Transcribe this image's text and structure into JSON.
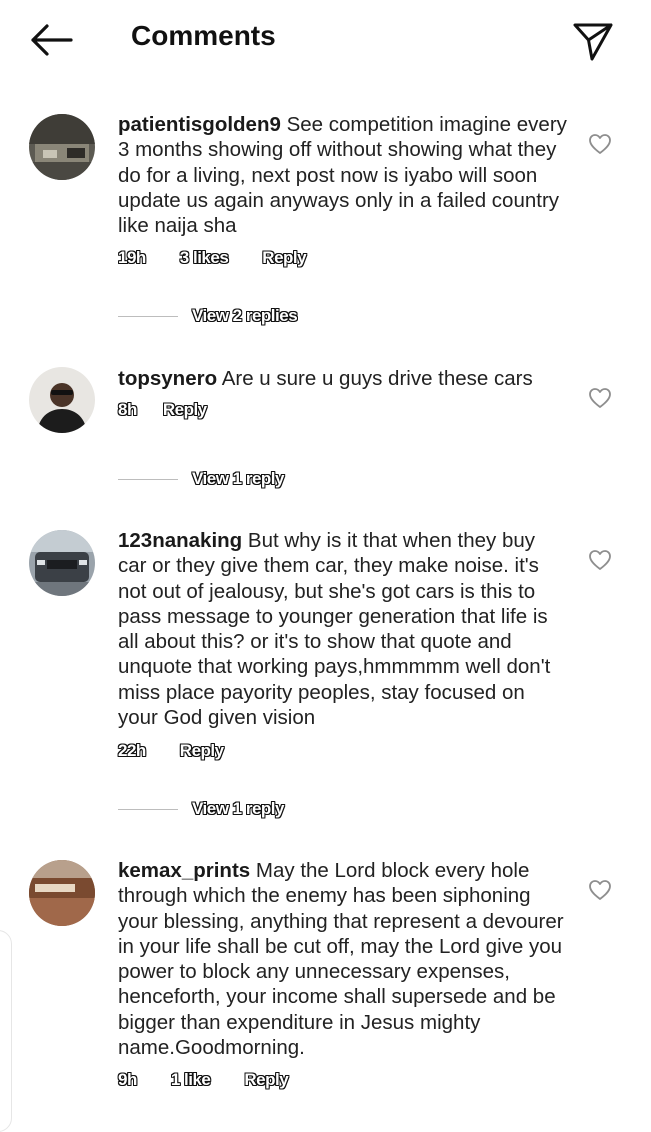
{
  "header": {
    "title": "Comments",
    "back_icon": "arrow-left-icon",
    "share_icon": "paper-plane-icon"
  },
  "comments": [
    {
      "username": "patientisgolden9",
      "text": "See competition imagine every 3 months showing off without showing what they do for a living, next post now is iyabo will soon update us again anyways only in a failed country like naija sha",
      "time": "19h",
      "likes": "3 likes",
      "reply": "Reply",
      "view_replies": "View 2 replies"
    },
    {
      "username": "topsynero",
      "text": "Are u sure u guys drive these cars",
      "time": "8h",
      "reply": "Reply",
      "view_replies": "View 1 reply"
    },
    {
      "username": "123nanaking",
      "text": "But why is it that when they buy car or they give them car, they make noise. it's not out of jealousy, but she's got cars is this to pass message to younger generation that life is all about this? or it's to show that quote and unquote that working pays,hmmmmm well don't miss place payority peoples, stay focused on your God given vision",
      "time": "22h",
      "reply": "Reply",
      "view_replies": "View 1 reply"
    },
    {
      "username": "kemax_prints",
      "text": "May the Lord block every hole through which the enemy has been siphoning your blessing, anything that represent a devourer in your life shall be cut off, may the Lord give you power to block any unnecessary expenses, henceforth, your income shall supersede and be bigger than expenditure in Jesus mighty name.Goodmorning.",
      "time": "9h",
      "likes": "1 like",
      "reply": "Reply"
    }
  ],
  "colors": {
    "background": "#ffffff",
    "text": "#262626",
    "divider": "#bdbdbd"
  }
}
